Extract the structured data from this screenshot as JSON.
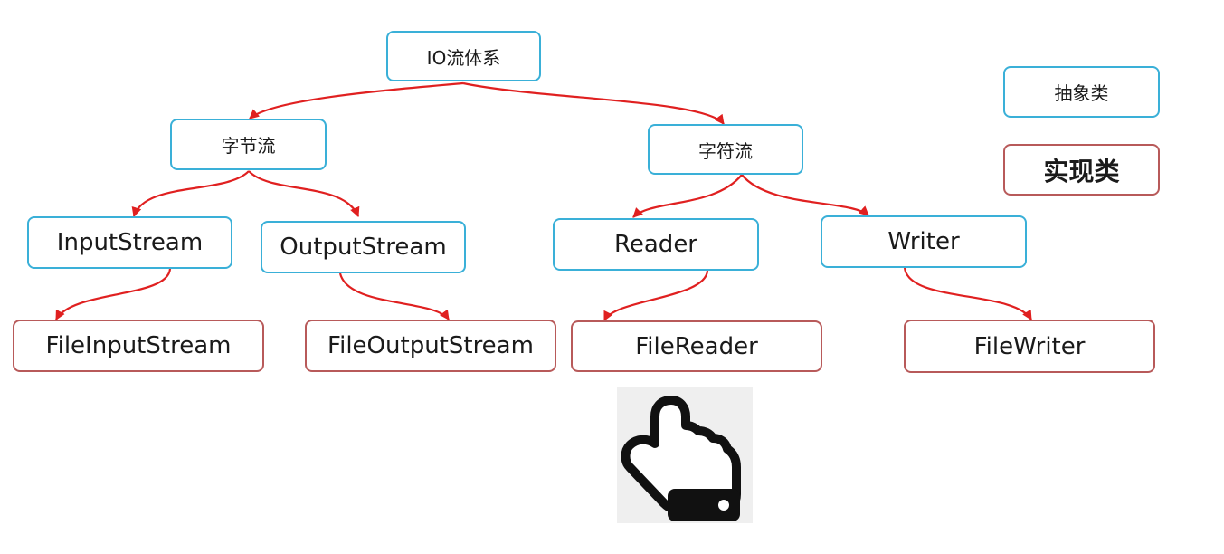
{
  "diagram": {
    "root": {
      "label": "IO流体系"
    },
    "byte_stream": {
      "label": "字节流"
    },
    "char_stream": {
      "label": "字符流"
    },
    "input_stream": {
      "label": "InputStream"
    },
    "output_stream": {
      "label": "OutputStream"
    },
    "reader": {
      "label": "Reader"
    },
    "writer": {
      "label": "Writer"
    },
    "file_input_stream": {
      "label": "FileInputStream"
    },
    "file_output_stream": {
      "label": "FileOutputStream"
    },
    "file_reader": {
      "label": "FileReader"
    },
    "file_writer": {
      "label": "FileWriter"
    }
  },
  "legend": {
    "abstract_label": "抽象类",
    "concrete_label": "实现类"
  },
  "colors": {
    "abstract_border": "#3ab0d8",
    "concrete_border": "#b85a5a",
    "edge": "#e02020"
  },
  "icons": {
    "pointer": "pointing-hand-icon"
  }
}
